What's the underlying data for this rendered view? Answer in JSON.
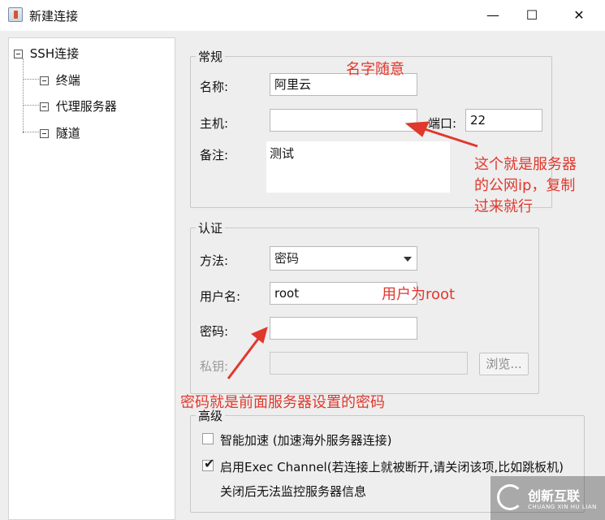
{
  "window": {
    "title": "新建连接",
    "minimize": "—",
    "maximize": "☐",
    "close": "✕"
  },
  "sidebar": {
    "root": "SSH连接",
    "items": [
      {
        "label": "终端"
      },
      {
        "label": "代理服务器"
      },
      {
        "label": "隧道"
      }
    ]
  },
  "general": {
    "legend": "常规",
    "name_label": "名称:",
    "name_value": "阿里云",
    "host_label": "主机:",
    "host_value": "",
    "port_label": "端口:",
    "port_value": "22",
    "note_label": "备注:",
    "note_value": "测试"
  },
  "auth": {
    "legend": "认证",
    "method_label": "方法:",
    "method_value": "密码",
    "username_label": "用户名:",
    "username_value": "root",
    "password_label": "密码:",
    "password_value": "",
    "key_label": "私钥:",
    "key_value": "",
    "browse_label": "浏览..."
  },
  "advanced": {
    "legend": "高级",
    "smart_accel_label": "智能加速 (加速海外服务器连接)",
    "smart_accel_checked": false,
    "exec_channel_label": "启用Exec Channel(若连接上就被断开,请关闭该项,比如跳板机)",
    "exec_channel_checked": true,
    "exec_channel_note": "关闭后无法监控服务器信息"
  },
  "annotations": {
    "name_note": "名字随意",
    "host_note_1": "这个就是服务器",
    "host_note_2": "的公网ip，复制",
    "host_note_3": "过来就行",
    "user_note": "用户为root",
    "password_note": "密码就是前面服务器设置的密码",
    "color": "#e0382d"
  },
  "watermark": {
    "text": "创新互联",
    "sub": "CHUANG XIN HU LIAN"
  }
}
